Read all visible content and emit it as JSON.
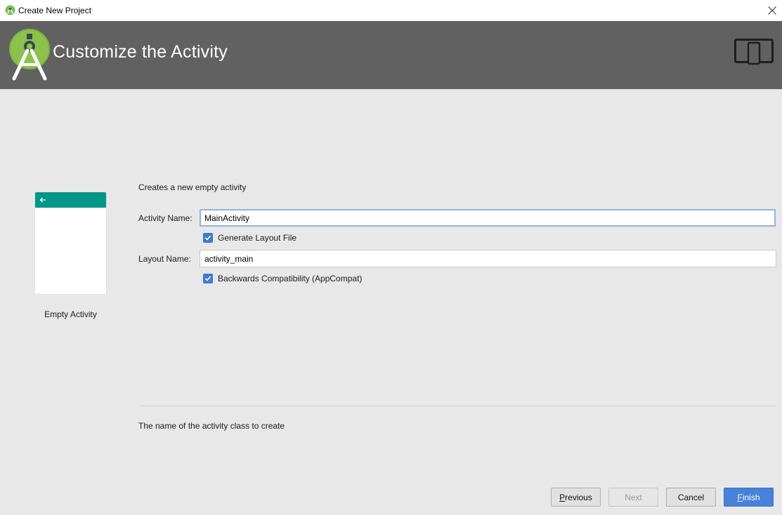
{
  "window": {
    "title": "Create New Project",
    "close_icon": "close-icon"
  },
  "header": {
    "title": "Customize the Activity",
    "logo_icon": "android-studio-logo-icon",
    "device_icon": "tablet-phone-icon"
  },
  "template": {
    "name": "Empty Activity",
    "description": "Creates a new empty activity",
    "toolbar_color": "#009688"
  },
  "form": {
    "activity_name": {
      "label": "Activity Name:",
      "value": "MainActivity"
    },
    "generate_layout": {
      "label": "Generate Layout File",
      "checked": true
    },
    "layout_name": {
      "label": "Layout Name:",
      "value": "activity_main"
    },
    "backwards_compat": {
      "label": "Backwards Compatibility (AppCompat)",
      "checked": true
    }
  },
  "hint": "The name of the activity class to create",
  "buttons": {
    "previous": {
      "mnemonic": "P",
      "rest": "revious"
    },
    "next": {
      "label": "Next"
    },
    "cancel": {
      "label": "Cancel"
    },
    "finish": {
      "mnemonic": "F",
      "rest": "inish"
    }
  },
  "colors": {
    "header_bg": "#616161",
    "accent": "#4682d9",
    "checkbox": "#3d7ad6"
  }
}
